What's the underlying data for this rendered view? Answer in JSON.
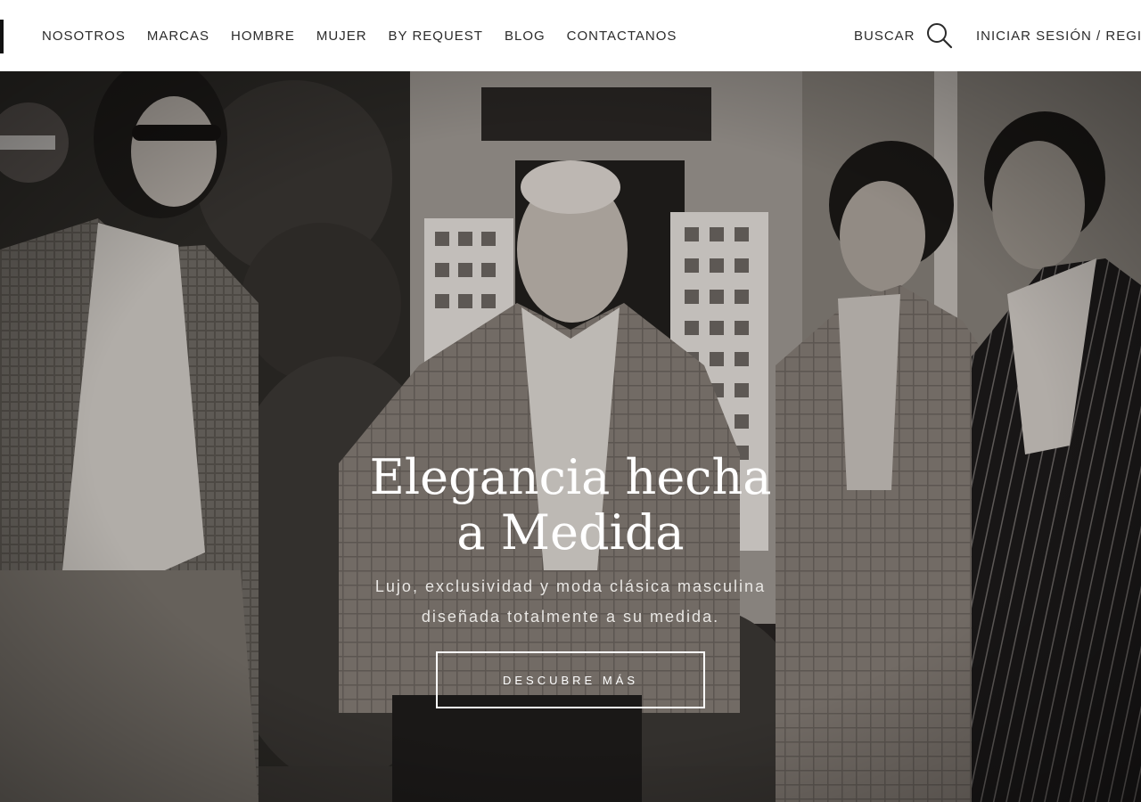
{
  "header": {
    "nav": [
      {
        "label": "NOSOTROS"
      },
      {
        "label": "MARCAS"
      },
      {
        "label": "HOMBRE"
      },
      {
        "label": "MUJER"
      },
      {
        "label": "BY REQUEST"
      },
      {
        "label": "BLOG"
      },
      {
        "label": "CONTACTANOS"
      }
    ],
    "search_label": "BUSCAR",
    "account_label": "INICIAR SESIÓN / REGISTRARSE"
  },
  "hero": {
    "title_line1": "Elegancia hecha",
    "title_line2": "a Medida",
    "subtitle_line1": "Lujo, exclusividad y moda clásica masculina",
    "subtitle_line2": "diseñada totalmente a su medida.",
    "cta_label": "DESCUBRE MÁS"
  },
  "icons": {
    "search": "search-icon",
    "logo": "logo-fragment"
  },
  "colors": {
    "header_bg": "#ffffff",
    "nav_text": "#2b2b2b",
    "hero_overlay_text": "#ffffff"
  }
}
